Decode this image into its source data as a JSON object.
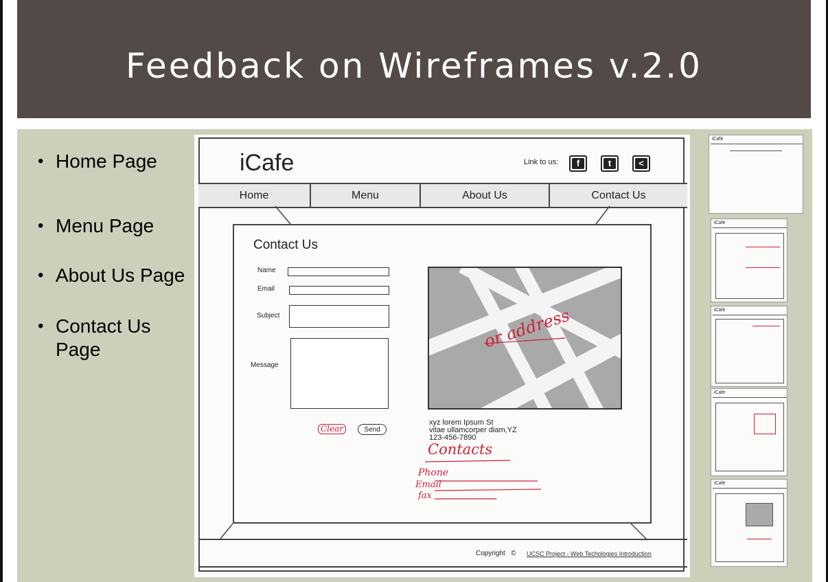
{
  "slide": {
    "title": "Feedback on Wireframes v.2.0",
    "bullets": [
      "Home Page",
      "Menu Page",
      "About Us Page",
      "Contact Us Page"
    ]
  },
  "wireframe": {
    "logo": "iCafe",
    "link_to_us": "Link to us:",
    "social_icons": [
      "facebook-icon",
      "twitter-icon",
      "share-icon"
    ],
    "nav": [
      "Home",
      "Menu",
      "About Us",
      "Contact Us"
    ],
    "form_title": "Contact Us",
    "fields": [
      "Name",
      "Email",
      "Subject",
      "Message"
    ],
    "clear_label": "Clear",
    "send_label": "Send",
    "address_lines": [
      "xyz lorem Ipsum St",
      "vitae ullamcorper diam,YZ",
      "123-456-7890"
    ],
    "handwritten": {
      "map_note": "or address",
      "contacts": "Contacts",
      "phone": "Phone",
      "email": "Email",
      "fax": "fax"
    },
    "copyright": "Copyright",
    "copyright_symbol": "©",
    "footer_link": "UCSC Project - Web Techologies Introduction"
  },
  "thumbnails": [
    {
      "label": "iCafe"
    },
    {
      "label": "iCafe"
    },
    {
      "label": "iCafe"
    },
    {
      "label": "iCafe"
    },
    {
      "label": "iCafe"
    }
  ],
  "colors": {
    "title_bar": "#534a48",
    "content_bg": "#ccd0bb",
    "annotation_red": "#d0203a"
  }
}
